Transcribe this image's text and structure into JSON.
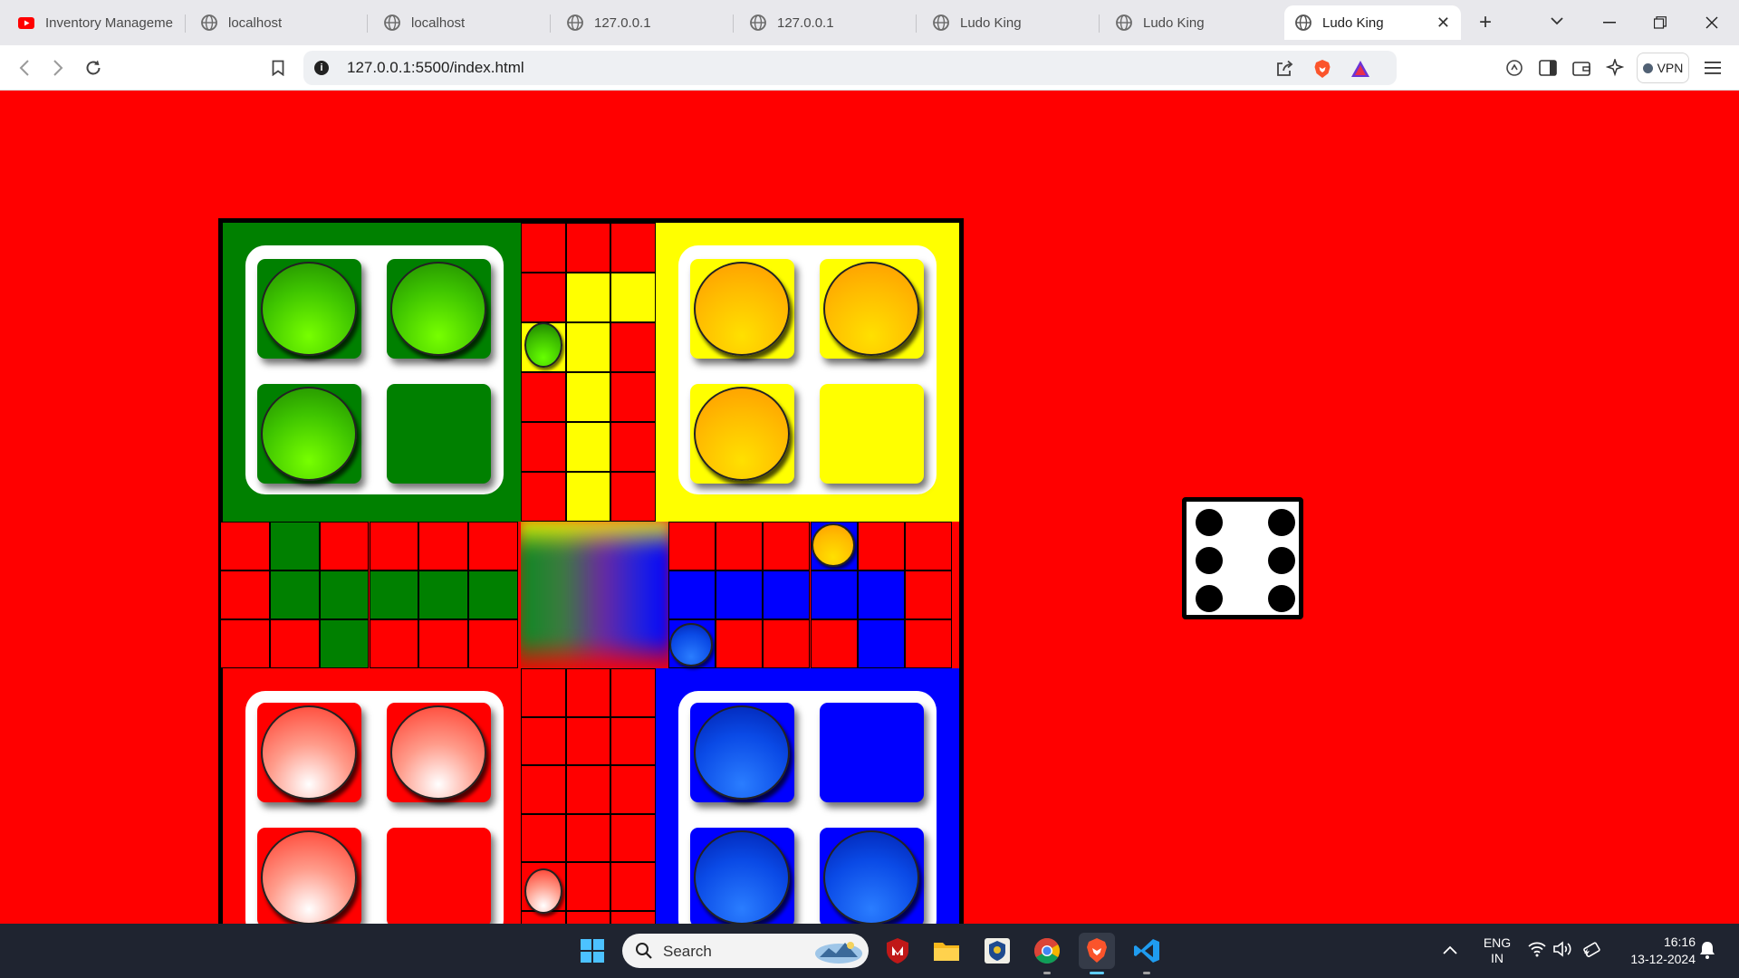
{
  "browser": {
    "tabs": [
      {
        "title": "Inventory Manageme",
        "icon": "youtube-icon"
      },
      {
        "title": "localhost",
        "icon": "globe-icon"
      },
      {
        "title": "localhost",
        "icon": "globe-icon"
      },
      {
        "title": "127.0.0.1",
        "icon": "globe-icon"
      },
      {
        "title": "127.0.0.1",
        "icon": "globe-icon"
      },
      {
        "title": "Ludo King",
        "icon": "globe-icon"
      },
      {
        "title": "Ludo King",
        "icon": "globe-icon"
      },
      {
        "title": "Ludo King",
        "icon": "globe-icon",
        "active": true
      }
    ],
    "new_tab": "+",
    "url": "127.0.0.1:5500/index.html",
    "vpn_label": "VPN"
  },
  "game": {
    "colors": {
      "green": "#008000",
      "yellow": "#ffff00",
      "red": "#ff0000",
      "blue": "#0000ff",
      "background": "#ff0000"
    },
    "homes": {
      "green": {
        "tokens_in_home": [
          true,
          true,
          true,
          false
        ]
      },
      "yellow": {
        "tokens_in_home": [
          true,
          true,
          true,
          false
        ]
      },
      "red": {
        "tokens_in_home": [
          true,
          true,
          true,
          false
        ]
      },
      "blue": {
        "tokens_in_home": [
          true,
          false,
          true,
          true
        ]
      }
    },
    "dice_value": 6
  },
  "taskbar": {
    "search_label": "Search",
    "language": "ENG",
    "region": "IN",
    "time": "16:16",
    "date": "13-12-2024"
  }
}
